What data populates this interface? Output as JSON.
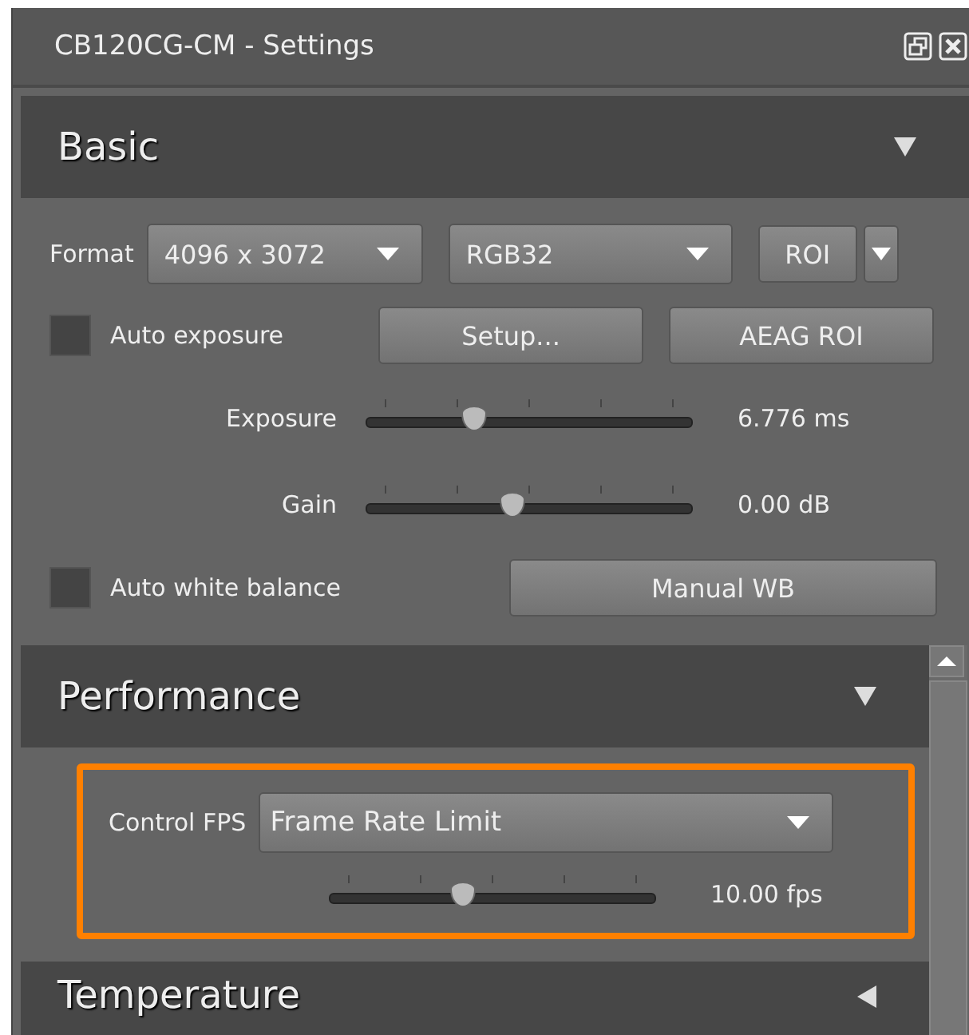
{
  "window": {
    "title": "CB120CG-CM - Settings"
  },
  "sections": [
    {
      "title": "Basic",
      "expanded": true,
      "kind": "basic",
      "format": {
        "label": "Format",
        "resolution": "4096 x 3072",
        "pixel_format": "RGB32",
        "roi_button": "ROI"
      },
      "auto_exposure": {
        "label": "Auto exposure",
        "checked": false,
        "buttons": [
          "Setup...",
          "AEAG ROI"
        ]
      },
      "sliders": [
        {
          "label": "Exposure",
          "level": 0.33,
          "reading": "6.776 ms"
        },
        {
          "label": "Gain",
          "level": 0.45,
          "reading": "0.00 dB"
        }
      ],
      "auto_white_balance": {
        "label": "Auto white balance",
        "checked": false,
        "button": "Manual WB"
      }
    },
    {
      "title": "Performance",
      "expanded": true,
      "kind": "performance",
      "control": {
        "label": "Control FPS",
        "value": "Frame Rate Limit",
        "highlighted": true
      },
      "slider": {
        "level": 0.41,
        "reading": "10.00 fps"
      }
    },
    {
      "title": "Temperature",
      "expanded": false,
      "kind": "collapsed"
    }
  ]
}
